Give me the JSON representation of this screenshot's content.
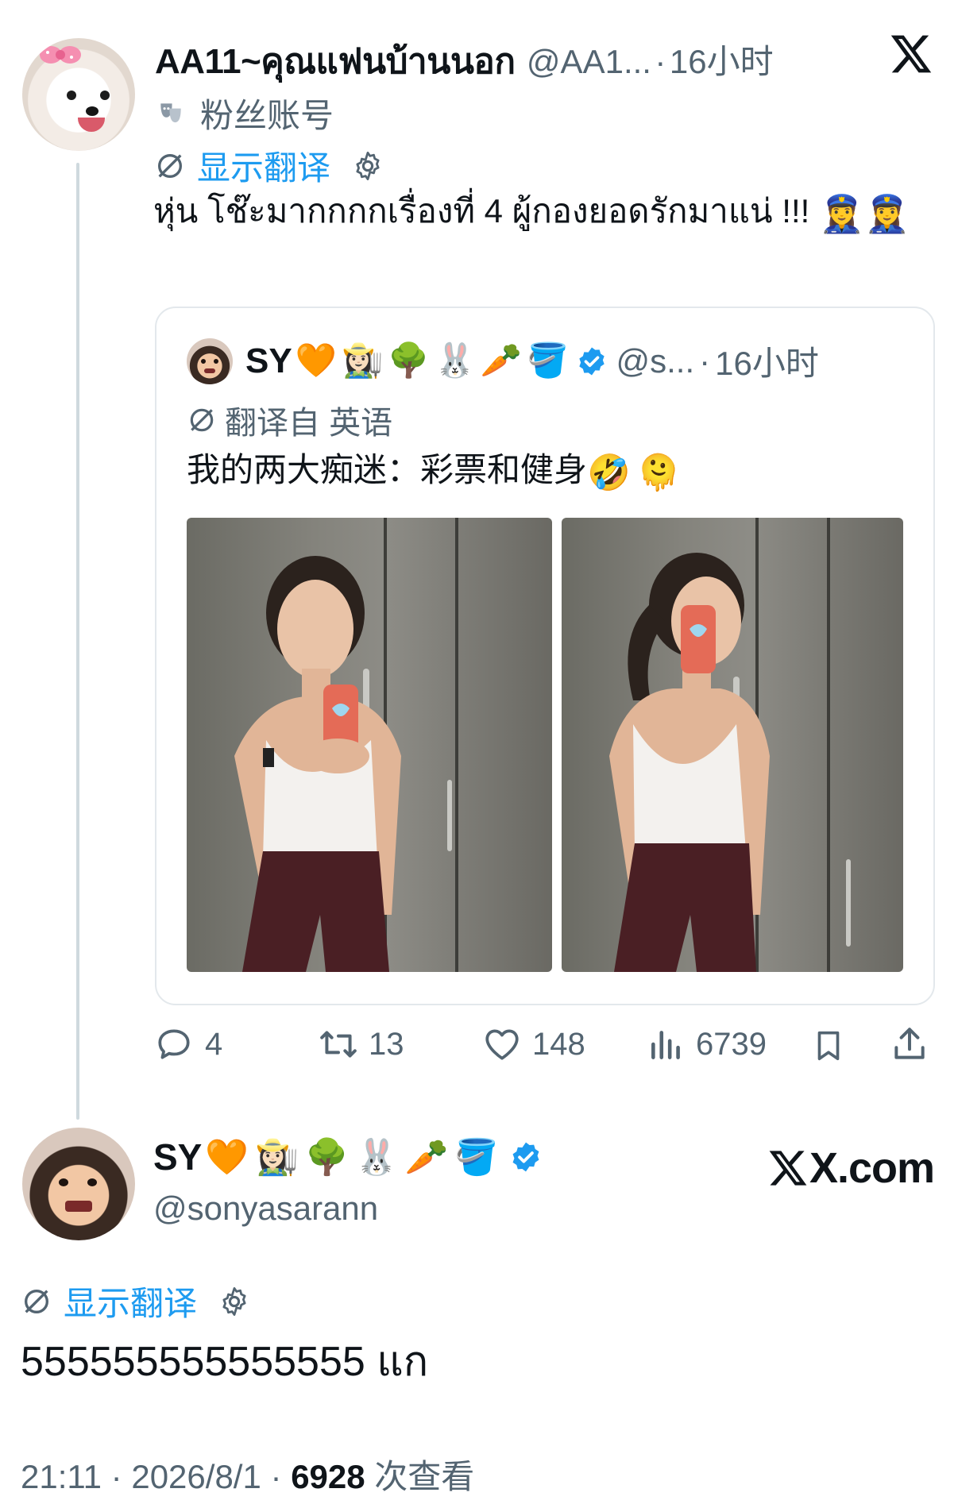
{
  "reply_tweet": {
    "display_name": "AA11~คุณแฟนบ้านนอก",
    "handle": "@AA1...",
    "separator": "·",
    "time_ago": "16小时",
    "account_label": "粉丝账号",
    "show_translation": "显示翻译",
    "text": "หุ่น โช๊ะมากกกกเรื่องที่ 4 ผู้กองยอดรักมาแน่ !!! ",
    "emoji_trailing": "👮‍♀️👮‍♀️",
    "quote": {
      "display_name": "SY",
      "name_emojis": "🧡👩🏻‍🌾🌳🐰🥕🪣",
      "handle": "@s...",
      "time_ago": "16小时",
      "translated_from": "翻译自 英语",
      "text": "我的两大痴迷：彩票和健身",
      "text_emojis": "🤣🫠",
      "images": [
        "photo-1",
        "photo-2"
      ]
    },
    "actions": {
      "replies": "4",
      "retweets": "13",
      "likes": "148",
      "views": "6739"
    }
  },
  "main_tweet": {
    "display_name": "SY",
    "name_emojis": "🧡👩🏻‍🌾🌳🐰🥕🪣",
    "handle": "@sonyasarann",
    "brand": "X.com",
    "show_translation": "显示翻译",
    "text": "555555555555555 แก",
    "timestamp": "21:11",
    "date": "2026/8/1",
    "views_count": "6928",
    "views_label": "次查看"
  },
  "colors": {
    "accent": "#1d9bf0",
    "muted": "#536471",
    "text": "#0f1419",
    "border": "#cfd9de"
  },
  "icons": [
    "x-logo-icon",
    "theater-mask-icon",
    "translate-icon",
    "gear-icon",
    "verified-badge-icon",
    "reply-icon",
    "retweet-icon",
    "like-icon",
    "views-icon",
    "bookmark-icon",
    "share-icon"
  ]
}
